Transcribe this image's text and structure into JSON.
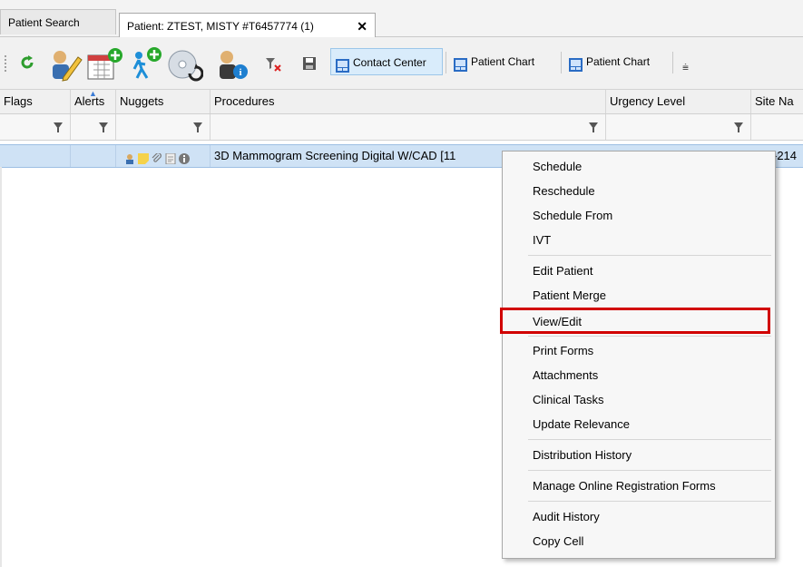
{
  "tabs": {
    "search_label": "Patient Search",
    "patient_label": "Patient: ZTEST, MISTY #T6457774 (1)",
    "close_glyph": "✕"
  },
  "toolbar": {
    "contact_center": "Contact Center",
    "patient_chart_1": "Patient Chart",
    "patient_chart_2": "Patient Chart",
    "overflow_glyph": "⩧",
    "icons": [
      "refresh-icon",
      "edit-patient-icon",
      "add-calendar-icon",
      "add-walker-icon",
      "disc-refresh-icon",
      "patient-info-icon",
      "clear-filter-icon",
      "save-icon"
    ]
  },
  "grid": {
    "columns": [
      "Flags",
      "Alerts",
      "Nuggets",
      "Procedures",
      "Urgency Level",
      "Site Na"
    ],
    "row": {
      "procedure": "3D Mammogram Screening Digital W/CAD [11",
      "site": "-214"
    }
  },
  "context_menu": {
    "items": [
      "Schedule",
      "Reschedule",
      "Schedule From",
      "IVT",
      "Edit Patient",
      "Patient Merge",
      "View/Edit",
      "Print Forms",
      "Attachments",
      "Clinical Tasks",
      "Update Relevance",
      "Distribution History",
      "Manage Online Registration Forms",
      "Audit History",
      "Copy Cell"
    ],
    "highlighted": "View/Edit"
  },
  "colors": {
    "selected_row": "#cfe2f5",
    "highlight_border": "#d10000",
    "active_button": "#d9ecfb"
  }
}
